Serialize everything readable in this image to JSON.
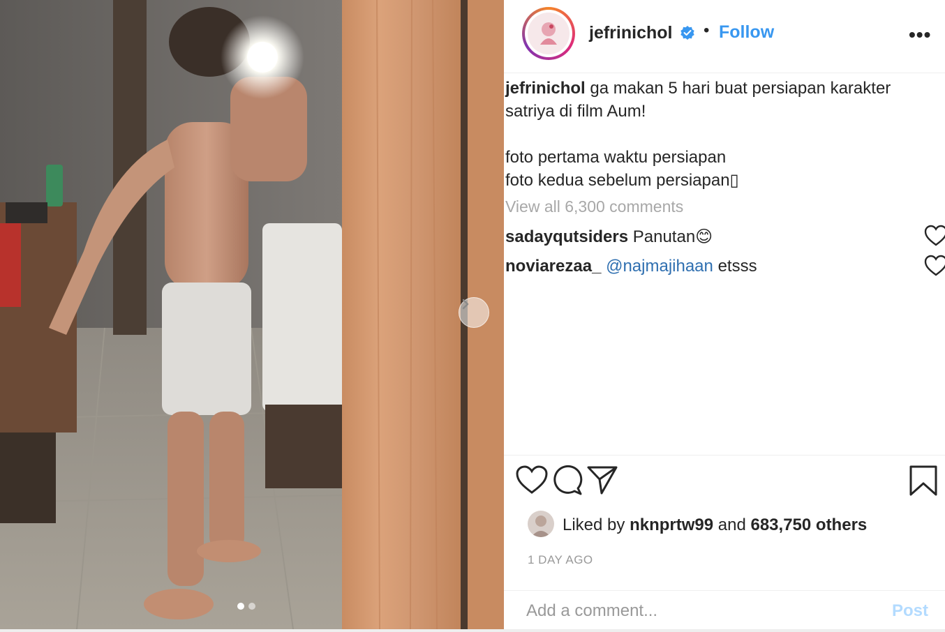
{
  "post": {
    "username": "jefrinichol",
    "verified": true,
    "separator": "•",
    "follow_label": "Follow",
    "more_label": "•••",
    "caption_lines": [
      "ga makan 5 hari buat persiapan karakter",
      "satriya di film Aum!",
      "",
      "foto pertama waktu persiapan",
      "foto kedua sebelum persiapan▯"
    ],
    "view_all_comments": "View all 6,300 comments",
    "comments": [
      {
        "username": "sadayqutsiders",
        "text": "Panutan",
        "emoji": "😊"
      },
      {
        "username": "noviarezaa_",
        "mention": "@najmajihaan",
        "text": "etsss"
      }
    ],
    "likes": {
      "prefix": "Liked by",
      "liker": "nknprtw99",
      "middle": "and",
      "count_text": "683,750 others"
    },
    "time_ago": "1 DAY AGO",
    "add_comment_placeholder": "Add a comment...",
    "post_button_label": "Post"
  },
  "carousel": {
    "total": 2,
    "current": 1
  },
  "icons": {
    "like": "heart-icon",
    "comment": "comment-bubble-icon",
    "share": "paper-plane-icon",
    "save": "bookmark-icon",
    "next": "chevron-right-icon",
    "verified": "verified-badge-icon"
  },
  "colors": {
    "accent_blue": "#3897f0",
    "post_disabled": "#b3dbff",
    "muted_text": "#999999",
    "verified": "#3897f0"
  }
}
